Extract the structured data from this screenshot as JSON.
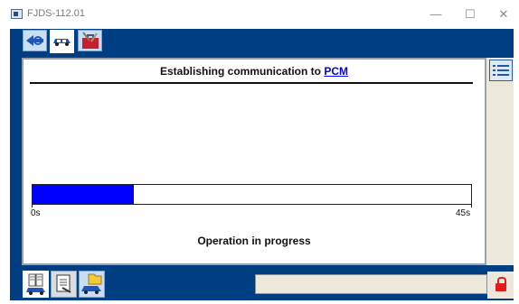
{
  "window": {
    "title": "FJDS-112.01",
    "minimize_glyph": "—",
    "maximize_glyph": "☐",
    "close_glyph": "✕"
  },
  "tabs": [
    {
      "name": "network-tab",
      "icon": "network-connector-icon"
    },
    {
      "name": "vehicle-tab",
      "icon": "vehicle-icon",
      "selected": true
    },
    {
      "name": "toolbox-tab",
      "icon": "toolbox-icon"
    }
  ],
  "panel": {
    "heading_prefix": "Establishing communication to ",
    "heading_link": "PCM",
    "progress_fraction": 0.23,
    "scale_start": "0s",
    "scale_end": "45s",
    "status": "Operation in progress"
  },
  "bottom_tabs": [
    {
      "name": "data-logger-tab",
      "icon": "data-logger-icon"
    },
    {
      "name": "report-tab",
      "icon": "report-icon"
    },
    {
      "name": "vehicle-folder-tab",
      "icon": "vehicle-folder-icon"
    }
  ],
  "colors": {
    "frame": "#003e84",
    "progress": "#0000ff",
    "link": "#0000ee",
    "lock": "#e21c1c"
  },
  "icons": {
    "menu": "list-menu-icon",
    "lock": "lock-icon"
  }
}
